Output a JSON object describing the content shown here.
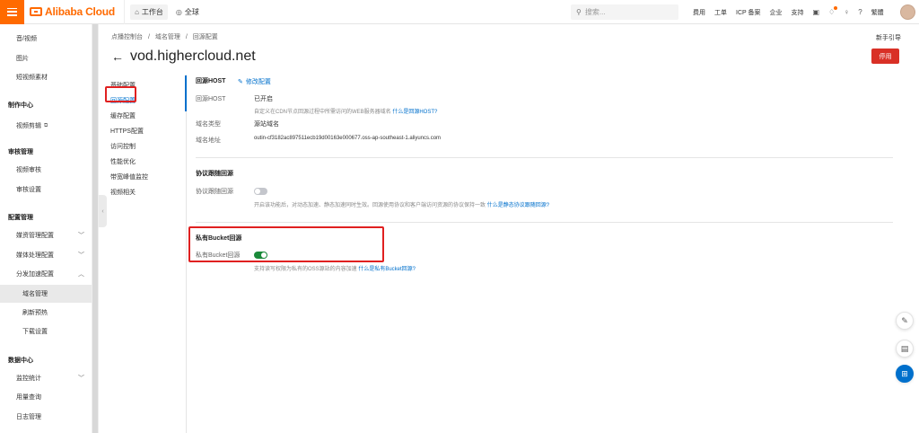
{
  "topbar": {
    "logo": "Alibaba Cloud",
    "workbench": "工作台",
    "region": "全球",
    "search_placeholder": "搜索...",
    "links": [
      "费用",
      "工单",
      "ICP 备案",
      "企业",
      "支持"
    ],
    "user": "繁體"
  },
  "sidebar": {
    "items": [
      {
        "label": "音/视频",
        "type": "sub"
      },
      {
        "label": "图片",
        "type": "sub"
      },
      {
        "label": "短视频素材",
        "type": "sub"
      },
      {
        "label": "制作中心",
        "type": "group"
      },
      {
        "label": "视频剪辑",
        "type": "sub",
        "external": true
      },
      {
        "label": "审核管理",
        "type": "group"
      },
      {
        "label": "视频审核",
        "type": "sub"
      },
      {
        "label": "审核设置",
        "type": "sub"
      },
      {
        "label": "配置管理",
        "type": "group"
      },
      {
        "label": "媒资管理配置",
        "type": "sub",
        "chevron": "down"
      },
      {
        "label": "媒体处理配置",
        "type": "sub",
        "chevron": "down"
      },
      {
        "label": "分发加速配置",
        "type": "sub",
        "chevron": "up"
      },
      {
        "label": "域名管理",
        "type": "subsub",
        "active": true
      },
      {
        "label": "刷新预热",
        "type": "subsub"
      },
      {
        "label": "下载设置",
        "type": "subsub"
      },
      {
        "label": "数据中心",
        "type": "group"
      },
      {
        "label": "监控统计",
        "type": "sub",
        "chevron": "down"
      },
      {
        "label": "用量查询",
        "type": "sub"
      },
      {
        "label": "日志管理",
        "type": "sub"
      }
    ]
  },
  "main": {
    "breadcrumb": [
      "点播控制台",
      "/",
      "域名管理",
      "/",
      "回源配置"
    ],
    "newbie_guide": "新手引导",
    "title": "vod.highercloud.net",
    "disable_button": "停用",
    "subnav": [
      "基础配置",
      "回源配置",
      "缓存配置",
      "HTTPS配置",
      "访问控制",
      "性能优化",
      "带宽峰值监控",
      "视频相关"
    ],
    "origin_host": {
      "title": "回源HOST",
      "edit": "修改配置",
      "host_label": "回源HOST",
      "host_value": "已开启",
      "host_help": "自定义在CDN节点回源过程中所需访问的WEB服务器域名",
      "host_help_link": "什么是回源HOST?",
      "type_label": "域名类型",
      "type_value": "源站域名",
      "addr_label": "域名地址",
      "addr_value": "outin-cf3182ac897511ecb19d00163e000677.oss-ap-southeast-1.aliyuncs.com"
    },
    "protocol": {
      "title": "协议跟随回源",
      "label": "协议跟随回源",
      "enabled": false,
      "help": "开启该功能后，对动态加速、静态加速同时生效。回源使用协议和客户端访问资源的协议保持一致",
      "help_link": "什么是静态协议跟随回源?"
    },
    "private_bucket": {
      "title": "私有Bucket回源",
      "label": "私有Bucket回源",
      "enabled": true,
      "help": "支持读写权限为私有的OSS源站的内容加速",
      "help_link": "什么是私有Bucket回源?"
    }
  }
}
